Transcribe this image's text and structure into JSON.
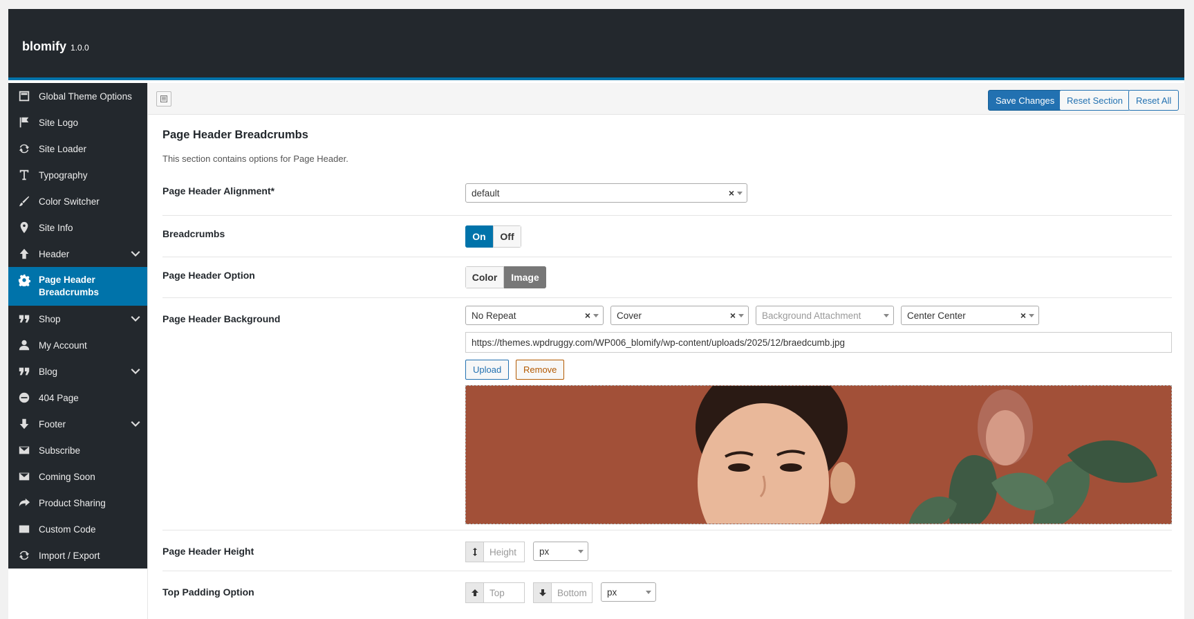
{
  "app": {
    "name": "blomify",
    "version": "1.0.0"
  },
  "sidebar": {
    "items": [
      {
        "label": "Global Theme Options",
        "icon": "layout-icon"
      },
      {
        "label": "Site Logo",
        "icon": "flag-icon"
      },
      {
        "label": "Site Loader",
        "icon": "refresh-icon"
      },
      {
        "label": "Typography",
        "icon": "text-icon"
      },
      {
        "label": "Color Switcher",
        "icon": "brush-icon"
      },
      {
        "label": "Site Info",
        "icon": "location-icon"
      },
      {
        "label": "Header",
        "icon": "arrow-up-icon",
        "expandable": true
      },
      {
        "label": "Page Header Breadcrumbs",
        "icon": "gear-icon",
        "active": true
      },
      {
        "label": "Shop",
        "icon": "quote-icon",
        "expandable": true
      },
      {
        "label": "My Account",
        "icon": "user-icon"
      },
      {
        "label": "Blog",
        "icon": "quote-icon",
        "expandable": true
      },
      {
        "label": "404 Page",
        "icon": "minus-circle-icon"
      },
      {
        "label": "Footer",
        "icon": "arrow-down-icon",
        "expandable": true
      },
      {
        "label": "Subscribe",
        "icon": "envelope-icon"
      },
      {
        "label": "Coming Soon",
        "icon": "envelope-icon"
      },
      {
        "label": "Product Sharing",
        "icon": "share-icon"
      },
      {
        "label": "Custom Code",
        "icon": "code-icon"
      },
      {
        "label": "Import / Export",
        "icon": "refresh-icon"
      }
    ]
  },
  "toolbar": {
    "save_label": "Save Changes",
    "reset_section_label": "Reset Section",
    "reset_all_label": "Reset All"
  },
  "section": {
    "title": "Page Header Breadcrumbs",
    "description": "This section contains options for Page Header."
  },
  "fields": {
    "alignment": {
      "label": "Page Header Alignment*",
      "value": "default"
    },
    "breadcrumbs": {
      "label": "Breadcrumbs",
      "on": "On",
      "off": "Off",
      "selected": "On"
    },
    "option": {
      "label": "Page Header Option",
      "color": "Color",
      "image": "Image",
      "selected": "Image"
    },
    "background": {
      "label": "Page Header Background",
      "repeat": "No Repeat",
      "size": "Cover",
      "attachment_placeholder": "Background Attachment",
      "position": "Center Center",
      "url": "https://themes.wpdruggy.com/WP006_blomify/wp-content/uploads/2025/12/braedcumb.jpg",
      "upload_label": "Upload",
      "remove_label": "Remove"
    },
    "height": {
      "label": "Page Header Height",
      "placeholder": "Height",
      "unit": "px"
    },
    "top_padding": {
      "label": "Top Padding Option",
      "top_placeholder": "Top",
      "bottom_placeholder": "Bottom",
      "unit": "px"
    }
  },
  "colors": {
    "accent": "#0073aa",
    "admin_dark": "#23282d",
    "remove": "#b35900"
  }
}
